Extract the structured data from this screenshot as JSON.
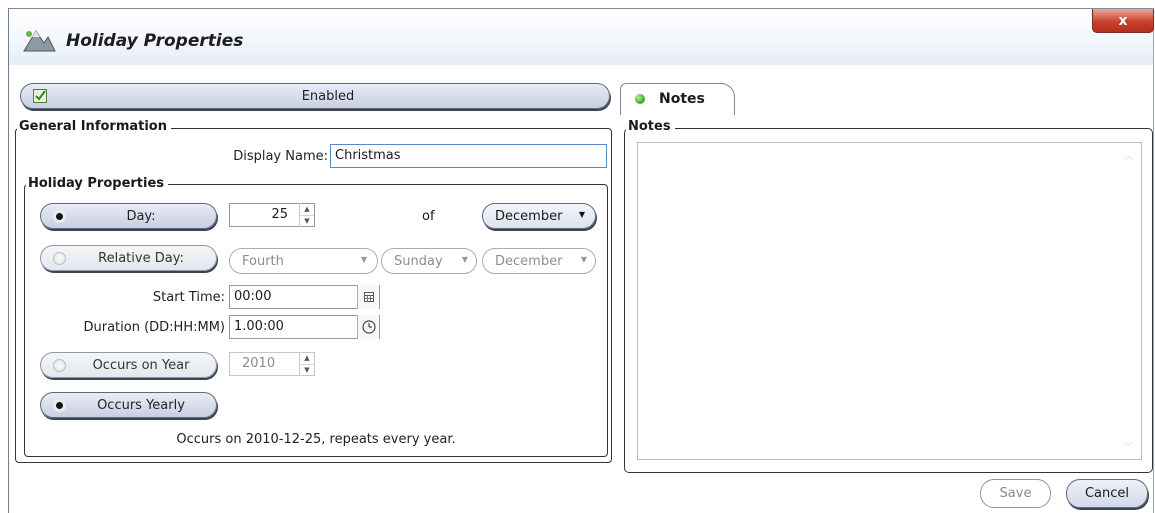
{
  "window": {
    "title": "Holiday Properties",
    "close_glyph": "x"
  },
  "enabled_toggle": {
    "label": "Enabled",
    "checked": true
  },
  "general_info": {
    "legend": "General Information",
    "display_name_label": "Display Name:",
    "display_name_value": "Christmas"
  },
  "holiday_props": {
    "legend": "Holiday Properties",
    "day": {
      "label": "Day:",
      "selected": true,
      "value": "25",
      "of_text": "of",
      "month": "December"
    },
    "relative_day": {
      "label": "Relative Day:",
      "selected": false,
      "ordinal": "Fourth",
      "weekday": "Sunday",
      "month": "December"
    },
    "start_time_label": "Start Time:",
    "start_time_value": "00:00",
    "duration_label": "Duration (DD:HH:MM)",
    "duration_value": "1.00:00",
    "occurs_on_year": {
      "label": "Occurs on Year",
      "selected": false,
      "value": "2010"
    },
    "occurs_yearly": {
      "label": "Occurs Yearly",
      "selected": true
    },
    "summary": "Occurs on 2010-12-25, repeats every year."
  },
  "notes": {
    "tab_label": "Notes",
    "legend": "Notes",
    "text": ""
  },
  "footer": {
    "save_label": "Save",
    "cancel_label": "Cancel"
  },
  "icons": {
    "app": "holiday-mountain-icon",
    "enabled": "checkbox-check-icon",
    "calendar": "calendar-icon",
    "clock": "clock-icon",
    "status": "green-dot-icon"
  },
  "colors": {
    "pill_gradient_top": "#e9ecf5",
    "pill_gradient_bottom": "#c9cfe4",
    "close_red": "#c9412b",
    "status_green": "#34a61e",
    "focus_border": "#5b87c6"
  }
}
